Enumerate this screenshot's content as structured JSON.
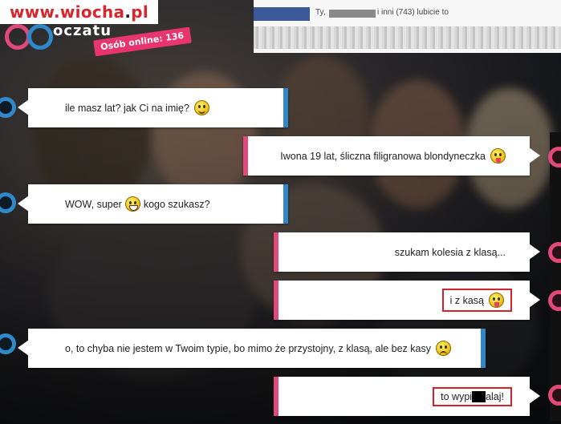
{
  "watermark": {
    "prefix": "www.",
    "brand": "wiocha",
    "dot": ".",
    "tld": "pl"
  },
  "header": {
    "online_label": "Osób online: 136",
    "logo_partial": "oczatu"
  },
  "facebook": {
    "like_text_pre": "Ty,",
    "like_text_post": "i inni (743) lubicie to"
  },
  "chat": {
    "messages": [
      {
        "side": "left",
        "text": "ile masz lat? jak Ci na imię?",
        "emoji": "smile-emoji"
      },
      {
        "side": "right",
        "text": "Iwona 19 lat, śliczna filigranowa blondyneczka",
        "emoji": "wink-emoji"
      },
      {
        "side": "left",
        "text_before": "WOW, super",
        "text_after": "kogo szukasz?",
        "emoji": "grin-emoji"
      },
      {
        "side": "right",
        "text": "szukam kolesia z klasą..."
      },
      {
        "side": "right",
        "text": "i z kasą",
        "emoji": "tongue-emoji",
        "highlighted": true
      },
      {
        "side": "left",
        "text": "o, to chyba nie jestem w Twoim typie, bo mimo że przystojny, z klasą, ale bez kasy",
        "emoji": "sad-emoji"
      },
      {
        "side": "right",
        "text_before": "to wypi",
        "text_after": "alaj!",
        "censored": true,
        "highlighted": true
      }
    ]
  },
  "colors": {
    "left_accent": "#2f88c9",
    "right_accent": "#e0497a",
    "highlight": "#d2232a"
  }
}
